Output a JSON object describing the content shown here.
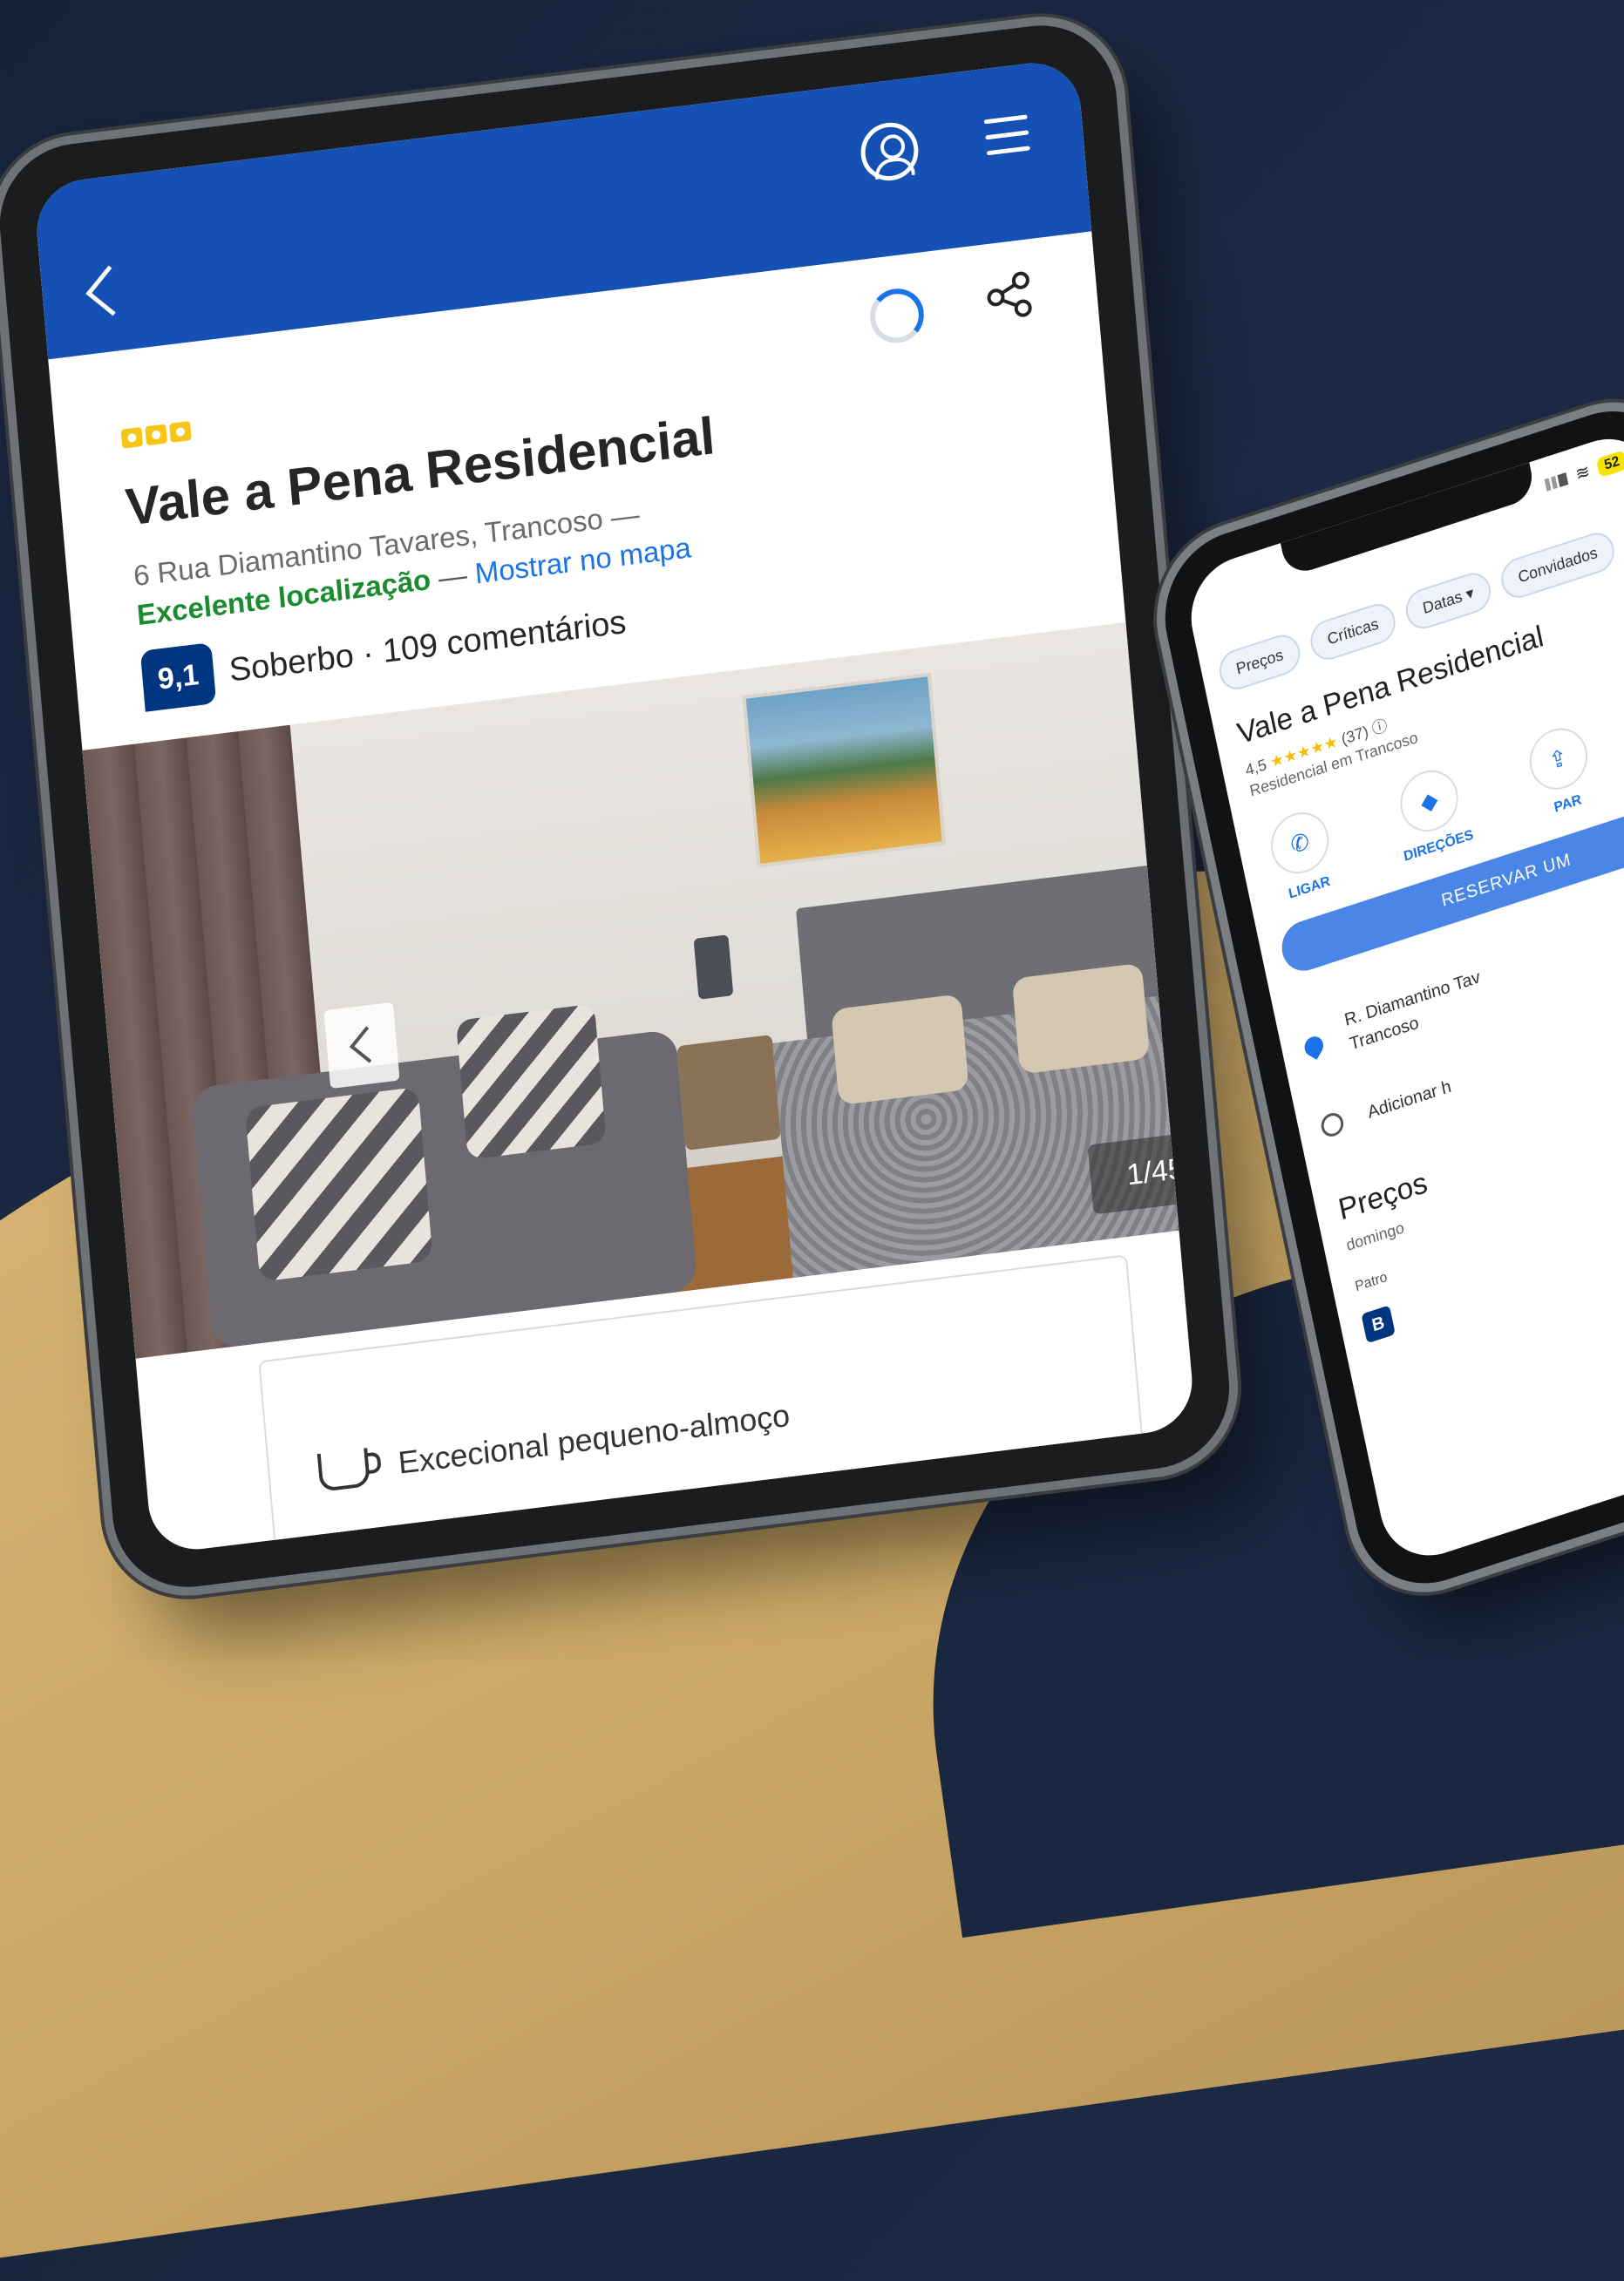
{
  "tablet": {
    "title": "Vale a Pena Residencial",
    "address": "6 Rua Diamantino Tavares, Trancoso —",
    "location_badge": "Excelente localização",
    "location_sep": " — ",
    "map_link": "Mostrar no mapa",
    "score": "9,1",
    "rating_text": "Soberbo · 109 comentários",
    "photo_counter": "1/45",
    "highlight": "Excecional pequeno-almoço",
    "colors": {
      "topbar": "#1550b4",
      "score_badge": "#003580",
      "location_green": "#1a8c2e",
      "link_blue": "#1a73e8"
    }
  },
  "phone": {
    "battery": "52",
    "chips": [
      "Preços",
      "Críticas",
      "Datas ▾",
      "Convidados"
    ],
    "title": "Vale a Pena Residencial",
    "rating": "4,5",
    "stars": "★★★★★",
    "review_count": "(37) ⓘ",
    "category": "Residencial em Trancoso",
    "actions": [
      {
        "label": "LIGAR",
        "icon": "phone-icon",
        "glyph": "✆"
      },
      {
        "label": "DIREÇÕES",
        "icon": "directions-icon",
        "glyph": "◆"
      },
      {
        "label": "PAR",
        "icon": "share-icon",
        "glyph": "⇪"
      }
    ],
    "reserve": "RESERVAR UM",
    "address": "R. Diamantino Tav\nTrancoso",
    "hours": "Adicionar h",
    "prices_title": "Preços",
    "prices_sub": "domingo",
    "sponsored": "Patro",
    "booking_letter": "B"
  }
}
